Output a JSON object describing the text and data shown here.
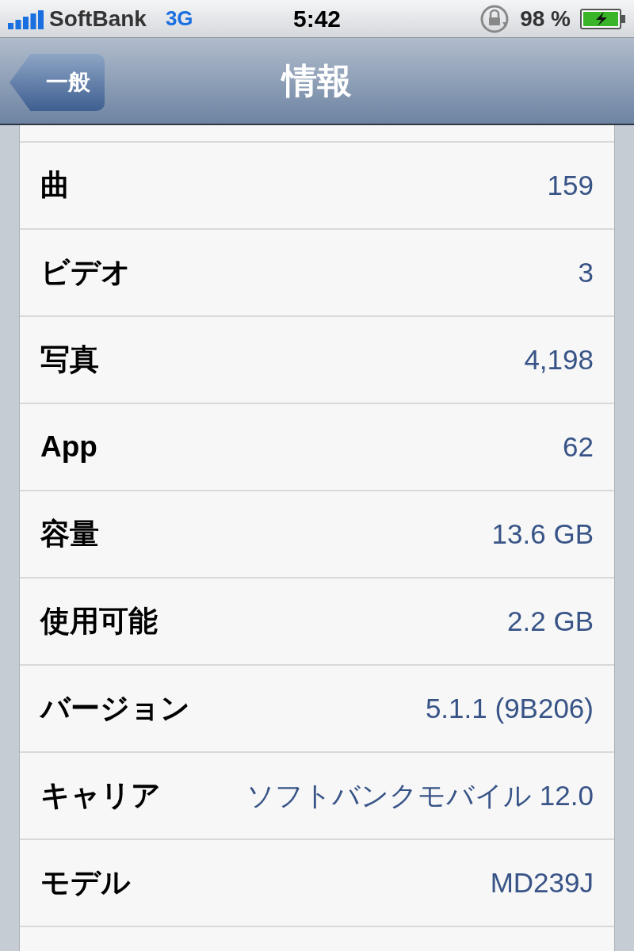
{
  "status_bar": {
    "carrier": "SoftBank",
    "network": "3G",
    "time": "5:42",
    "battery": "98 %"
  },
  "nav_bar": {
    "back": "一般",
    "title": "情報"
  },
  "rows": [
    {
      "label": "曲",
      "value": "159"
    },
    {
      "label": "ビデオ",
      "value": "3"
    },
    {
      "label": "写真",
      "value": "4,198"
    },
    {
      "label": "App",
      "value": "62"
    },
    {
      "label": "容量",
      "value": "13.6 GB"
    },
    {
      "label": "使用可能",
      "value": "2.2 GB"
    },
    {
      "label": "バージョン",
      "value": "5.1.1 (9B206)"
    },
    {
      "label": "キャリア",
      "value": "ソフトバンクモバイル 12.0"
    },
    {
      "label": "モデル",
      "value": "MD239J"
    }
  ]
}
